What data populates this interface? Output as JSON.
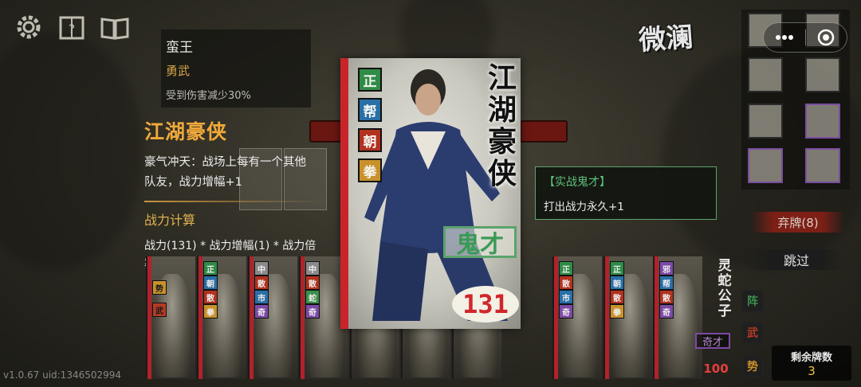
{
  "top_icons": [
    "gear-icon",
    "help-book-icon",
    "open-book-icon"
  ],
  "enemy": {
    "name": "蛮王",
    "type": "勇武",
    "desc": "受到伤害减少30%"
  },
  "hero_panel": {
    "title": "江湖豪侠",
    "skill_text": "豪气冲天：战场上每有一个其他队友，战力增幅+1",
    "calc_title": "战力计算",
    "calc_formula": "战力(131) * 战力增幅(1) * 战力倍率(1)"
  },
  "card": {
    "name": "江湖豪侠",
    "tags": [
      "正",
      "帮",
      "朝",
      "拳"
    ],
    "tag_colors": [
      "#2f8b46",
      "#2a6fa8",
      "#b2321f",
      "#c8912b"
    ],
    "trait": "鬼才",
    "power": "131"
  },
  "tooltip": {
    "title": "【实战鬼才】",
    "text": "打出战力永久+1"
  },
  "top_right": {
    "logo_text": "微澜",
    "capsule_menu": "more-dots-icon",
    "capsule_close": "record-circle-icon"
  },
  "equip_slots": [
    "lantern-icon",
    "crate-icon",
    "fortress-icon",
    "armor-icon",
    "blade-icon",
    "chest-icon",
    "pavilion-icon",
    "pouch-icon"
  ],
  "actions": {
    "discard_label": "弃牌(8)",
    "skip_label": "跳过"
  },
  "side_tags": [
    "阵",
    "武",
    "势"
  ],
  "side_tag_colors": [
    "#3c8f4a",
    "#b53a25",
    "#c8912b"
  ],
  "deck": {
    "label": "剩余牌数",
    "count": "3"
  },
  "hand_cards": [
    {
      "tags": [
        "势",
        "武"
      ]
    },
    {
      "tags": [
        "正",
        "朝",
        "散",
        "拳"
      ]
    },
    {
      "tags": [
        "中",
        "散",
        "市",
        "奇"
      ]
    },
    {
      "tags": [
        "中",
        "散",
        "蛇",
        "奇"
      ]
    },
    {
      "tags": []
    },
    {
      "tags": []
    },
    {
      "tags": []
    },
    {
      "tags": [
        "正",
        "散",
        "市",
        "奇"
      ]
    },
    {
      "tags": [
        "正",
        "朝",
        "散",
        "拳"
      ]
    },
    {
      "tags": [
        "邪",
        "帮",
        "散",
        "奇"
      ]
    }
  ],
  "last_card": {
    "name": "灵蛇公子",
    "trait": "奇才",
    "power": "100"
  },
  "version": "v1.0.67 uid:1346502994"
}
